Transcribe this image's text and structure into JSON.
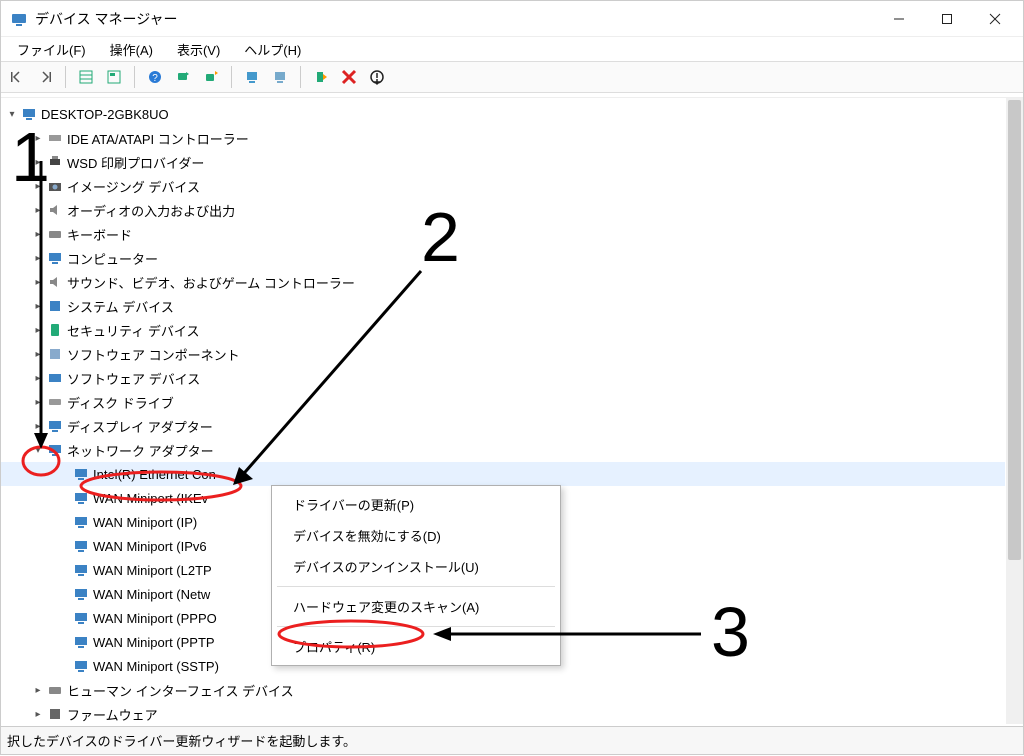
{
  "title": "デバイス マネージャー",
  "menu": {
    "file": "ファイル(F)",
    "action": "操作(A)",
    "view": "表示(V)",
    "help": "ヘルプ(H)"
  },
  "tree": {
    "root": "DESKTOP-2GBK8UO",
    "items": [
      "IDE ATA/ATAPI コントローラー",
      "WSD 印刷プロバイダー",
      "イメージング デバイス",
      "オーディオの入力および出力",
      "キーボード",
      "コンピューター",
      "サウンド、ビデオ、およびゲーム コントローラー",
      "システム デバイス",
      "セキュリティ デバイス",
      "ソフトウェア コンポーネント",
      "ソフトウェア デバイス",
      "ディスク ドライブ",
      "ディスプレイ アダプター",
      "ネットワーク アダプター"
    ],
    "network_children": [
      "Intel(R) Ethernet Con",
      "WAN Miniport (IKEv",
      "WAN Miniport (IP)",
      "WAN Miniport (IPv6",
      "WAN Miniport (L2TP",
      "WAN Miniport (Netw",
      "WAN Miniport (PPPO",
      "WAN Miniport (PPTP",
      "WAN Miniport (SSTP)"
    ],
    "tail": [
      "ヒューマン インターフェイス デバイス",
      "ファームウェア"
    ]
  },
  "context_menu": {
    "update": "ドライバーの更新(P)",
    "disable": "デバイスを無効にする(D)",
    "uninstall": "デバイスのアンインストール(U)",
    "scan": "ハードウェア変更のスキャン(A)",
    "properties": "プロパティ(R)"
  },
  "status": "択したデバイスのドライバー更新ウィザードを起動します。",
  "annotations": {
    "n1": "1",
    "n2": "2",
    "n3": "3"
  }
}
